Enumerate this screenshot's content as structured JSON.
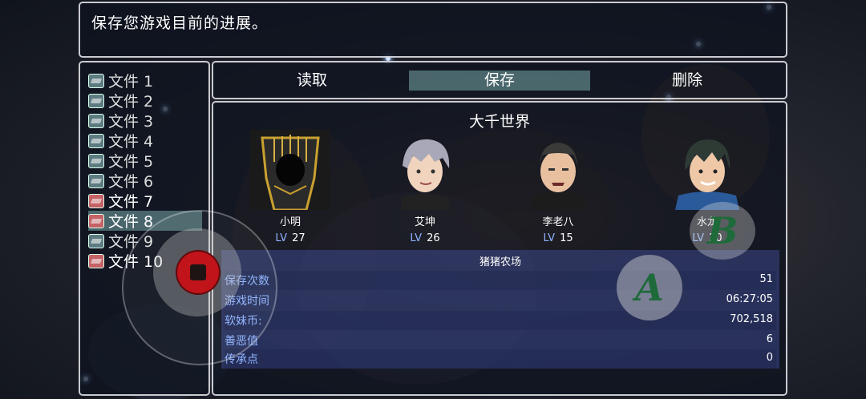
{
  "help": {
    "text": "保存您游戏目前的进展。"
  },
  "files": [
    {
      "label": "文件 1",
      "state": "empty",
      "selected": false
    },
    {
      "label": "文件 2",
      "state": "empty",
      "selected": false
    },
    {
      "label": "文件 3",
      "state": "empty",
      "selected": false
    },
    {
      "label": "文件 4",
      "state": "empty",
      "selected": false
    },
    {
      "label": "文件 5",
      "state": "empty",
      "selected": false
    },
    {
      "label": "文件 6",
      "state": "empty",
      "selected": false
    },
    {
      "label": "文件 7",
      "state": "saved",
      "selected": false
    },
    {
      "label": "文件 8",
      "state": "saved",
      "selected": true
    },
    {
      "label": "文件 9",
      "state": "empty",
      "selected": false
    },
    {
      "label": "文件 10",
      "state": "saved",
      "selected": false
    }
  ],
  "commands": [
    {
      "label": "读取",
      "active": false
    },
    {
      "label": "保存",
      "active": true
    },
    {
      "label": "删除",
      "active": false
    }
  ],
  "save_info": {
    "world": "大千世界",
    "actors": [
      {
        "name": "小明",
        "lv_tag": "LV",
        "level": "27",
        "portrait": "hooded-figure-portrait-icon"
      },
      {
        "name": "艾坤",
        "lv_tag": "LV",
        "level": "26",
        "portrait": "silver-hair-boy-portrait-icon"
      },
      {
        "name": "李老八",
        "lv_tag": "LV",
        "level": "15",
        "portrait": "buzzcut-man-portrait-icon"
      },
      {
        "name": "水龙",
        "lv_tag": "LV",
        "level": "20",
        "portrait": "green-hair-man-portrait-icon"
      }
    ],
    "map_name": "猪猪农场",
    "stats": [
      {
        "label": "保存次数",
        "value": "51"
      },
      {
        "label": "游戏时间",
        "value": "06:27:05"
      },
      {
        "label": "软妹币:",
        "value": "702,518"
      },
      {
        "label": "善恶值",
        "value": "6"
      },
      {
        "label": "传承点",
        "value": "0"
      }
    ]
  },
  "controls": {
    "a_label": "A",
    "b_label": "B"
  },
  "colors": {
    "selection": "#78aaaa",
    "lv_blue": "#8fb3ff",
    "joystick_red": "#c0141a",
    "button_green": "#1f6a3a"
  }
}
